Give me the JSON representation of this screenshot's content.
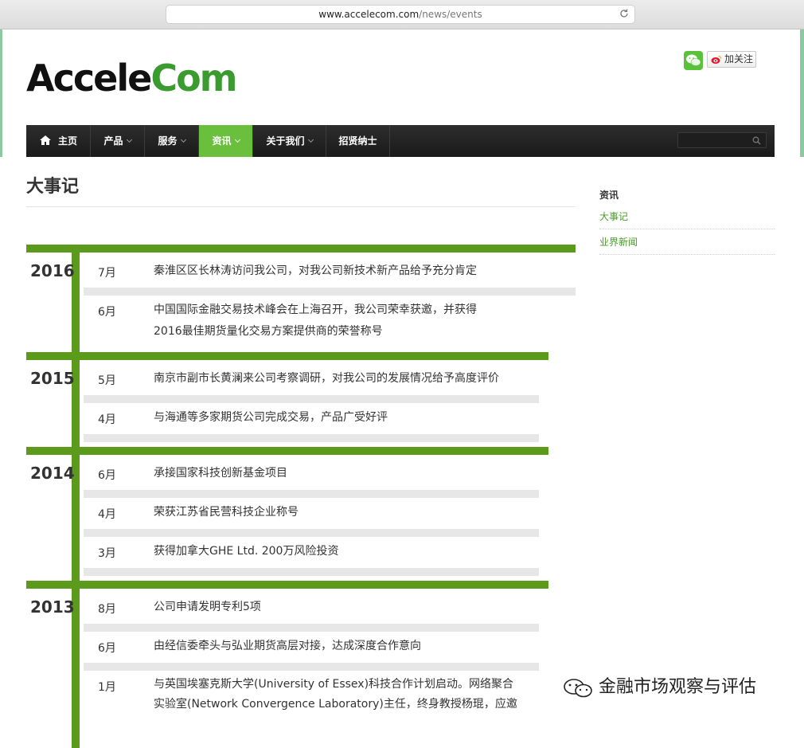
{
  "browser": {
    "url_host": "www.accelecom.com",
    "url_path": "/news/events"
  },
  "brand": {
    "logo_part1": "Accele",
    "logo_part2": "Com",
    "dark": "#111111",
    "green": "#3a9b2f"
  },
  "social": {
    "follow_label": "加关注",
    "wechat_icon": "wechat-icon",
    "weibo_icon": "weibo-icon"
  },
  "nav": {
    "items": [
      {
        "label": "主页",
        "icon": "home-icon"
      },
      {
        "label": "产品",
        "has_dropdown": true
      },
      {
        "label": "服务",
        "has_dropdown": true
      },
      {
        "label": "资讯",
        "has_dropdown": true,
        "active": true
      },
      {
        "label": "关于我们",
        "has_dropdown": true
      },
      {
        "label": "招贤纳士"
      }
    ],
    "search_placeholder": "",
    "active_color": "#6abf3d"
  },
  "page": {
    "title": "大事记"
  },
  "timeline": [
    {
      "year": "2016",
      "entries": [
        {
          "month": "7月",
          "lines": [
            "秦淮区区长林涛访问我公司，对我公司新技术新产品给予充分肯定"
          ]
        },
        {
          "month": "6月",
          "lines": [
            "中国国际金融交易技术峰会在上海召开，我公司荣幸获邀，并获得",
            "2016最佳期货量化交易方案提供商的荣誉称号"
          ]
        }
      ]
    },
    {
      "year": "2015",
      "entries": [
        {
          "month": "5月",
          "lines": [
            "南京市副市长黄澜来公司考察调研，对我公司的发展情况给予高度评价"
          ]
        },
        {
          "month": "4月",
          "lines": [
            "与海通等多家期货公司完成交易，产品广受好评"
          ]
        }
      ]
    },
    {
      "year": "2014",
      "entries": [
        {
          "month": "6月",
          "lines": [
            "承接国家科技创新基金项目"
          ]
        },
        {
          "month": "4月",
          "lines": [
            "荣获江苏省民营科技企业称号"
          ]
        },
        {
          "month": "3月",
          "lines": [
            "获得加拿大GHE Ltd. 200万风险投资"
          ]
        }
      ]
    },
    {
      "year": "2013",
      "entries": [
        {
          "month": "8月",
          "lines": [
            "公司申请发明专利5项"
          ]
        },
        {
          "month": "6月",
          "lines": [
            "由经信委牵头与弘业期货高层对接，达成深度合作意向"
          ]
        },
        {
          "month": "1月",
          "lines": [
            "与英国埃塞克斯大学(University of Essex)科技合作计划启动。网络聚合",
            "实验室(Network Convergence Laboratory)主任，终身教授杨琨，应邀"
          ]
        }
      ]
    }
  ],
  "sidebar": {
    "heading": "资讯",
    "links": [
      "大事记",
      "业界新闻"
    ]
  },
  "watermark": {
    "text": "金融市场观察与评估"
  }
}
